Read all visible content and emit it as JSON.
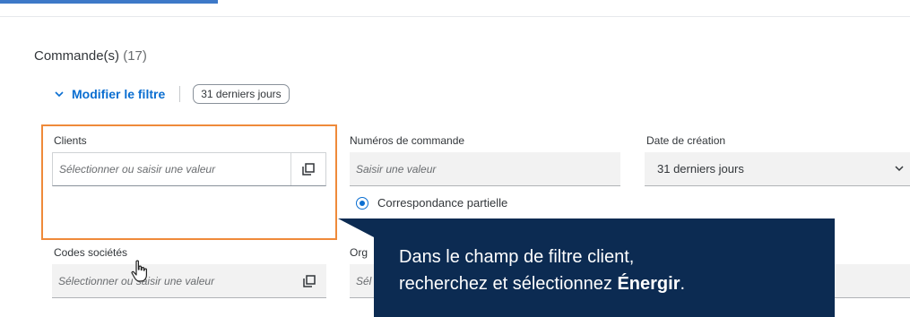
{
  "orders": {
    "title": "Commande(s)",
    "count": "(17)"
  },
  "filter": {
    "toggle_label": "Modifier le filtre",
    "period_token": "31 derniers jours"
  },
  "fields": {
    "clients": {
      "label": "Clients",
      "placeholder": "Sélectionner ou saisir une valeur"
    },
    "order_numbers": {
      "label": "Numéros de commande",
      "placeholder": "Saisir une valeur"
    },
    "creation_date": {
      "label": "Date de création",
      "value": "31 derniers jours"
    },
    "company_codes": {
      "label": "Codes sociétés",
      "placeholder": "Sélectionner ou saisir une valeur"
    },
    "org": {
      "label": "Org",
      "placeholder": "Sél"
    }
  },
  "match_option": {
    "label": "Correspondance partielle",
    "selected": true
  },
  "callout": {
    "line1": "Dans le champ de filtre client,",
    "line2_prefix": "recherchez et sélectionnez ",
    "line2_bold": "Énergir",
    "line2_suffix": "."
  },
  "colors": {
    "accent": "#0a6ed1",
    "highlight": "#ef8a3a",
    "callout_bg": "#0c2b52",
    "tab_indicator": "#3d79c8"
  },
  "icons": {
    "value_help": "value-help-icon",
    "dropdown": "chevron-down-icon",
    "filter_toggle": "chevron-down-icon",
    "cursor": "hand-cursor-icon"
  }
}
